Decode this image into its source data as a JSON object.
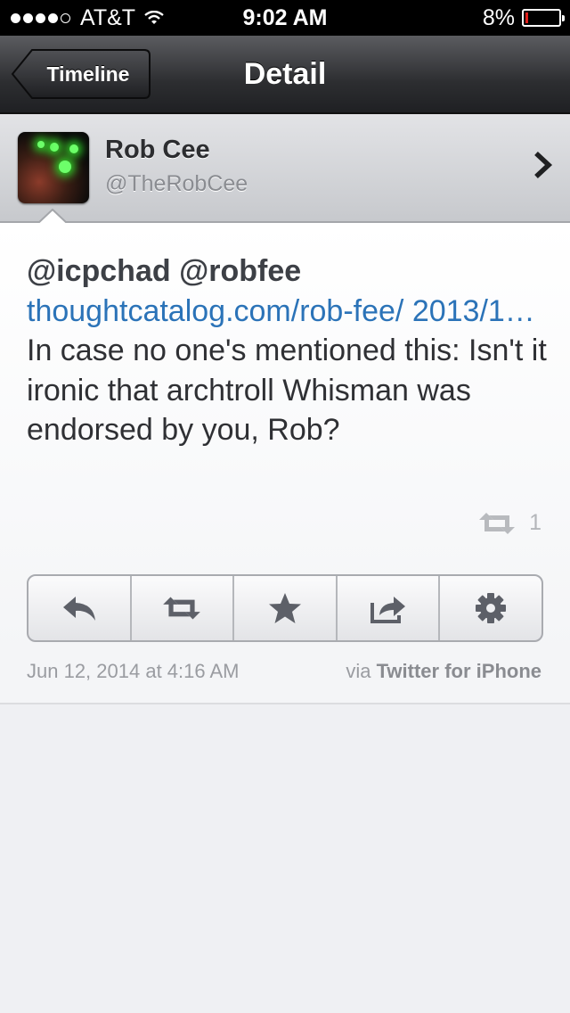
{
  "status_bar": {
    "carrier": "AT&T",
    "time": "9:02 AM",
    "battery_percent": "8%",
    "battery_level": 0.08,
    "signal_bars": 4
  },
  "nav": {
    "back_label": "Timeline",
    "title": "Detail"
  },
  "author": {
    "name": "Rob Cee",
    "handle": "@TheRobCee"
  },
  "tweet": {
    "mention_1": "@icpchad",
    "mention_2": "@robfee",
    "link": "thoughtcatalog.com/rob-fee/ 2013/1…",
    "text": "In case no one's mentioned this: Isn't it ironic that archtroll Whisman was endorsed by you, Rob?",
    "retweet_count": "1",
    "date": "Jun 12, 2014 at 4:16 AM",
    "via_prefix": "via",
    "via_app": "Twitter for iPhone"
  },
  "actions": [
    {
      "icon": "reply-icon"
    },
    {
      "icon": "retweet-icon"
    },
    {
      "icon": "star-icon"
    },
    {
      "icon": "share-icon"
    },
    {
      "icon": "gear-icon"
    }
  ],
  "colors": {
    "link": "#2b73b8",
    "nav_bar": "#2d2e31",
    "battery_low": "#e0201c"
  }
}
